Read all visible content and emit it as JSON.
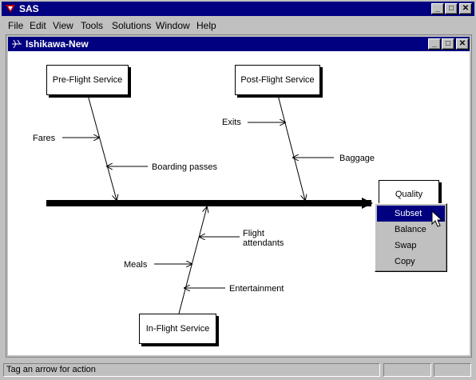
{
  "app": {
    "title": "SAS"
  },
  "menu": [
    "File",
    "Edit",
    "View",
    "Tools",
    "Solutions",
    "Window",
    "Help"
  ],
  "child_window": {
    "title": "Ishikawa-New"
  },
  "diagram": {
    "boxes": {
      "pre_flight": "Pre-Flight Service",
      "post_flight": "Post-Flight Service",
      "in_flight": "In-Flight Service",
      "effect": "Quality"
    },
    "labels": {
      "fares": "Fares",
      "boarding_passes": "Boarding passes",
      "exits": "Exits",
      "baggage": "Baggage",
      "flight_attendants_1": "Flight",
      "flight_attendants_2": "attendants",
      "meals": "Meals",
      "entertainment": "Entertainment"
    }
  },
  "context_menu": {
    "items": [
      "Subset",
      "Balance",
      "Swap",
      "Copy"
    ],
    "selected": "Subset"
  },
  "status": {
    "message": "Tag an arrow for action"
  }
}
